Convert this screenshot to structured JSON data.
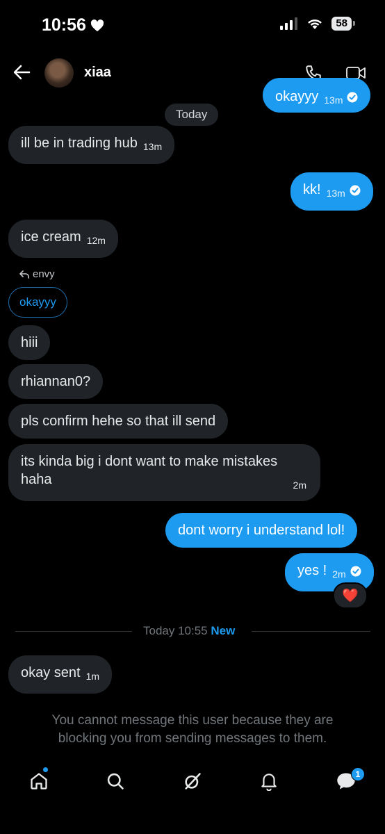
{
  "status_bar": {
    "time": "10:56",
    "battery": "58"
  },
  "header": {
    "name": "xiaa"
  },
  "messages": {
    "out_top": {
      "text": "okayyy",
      "time": "13m"
    },
    "date_pill": "Today",
    "m1": {
      "text": "ill be in trading hub",
      "time": "13m"
    },
    "m2": {
      "text": "kk!",
      "time": "13m"
    },
    "m3": {
      "text": "ice cream",
      "time": "12m"
    },
    "reply_to": "envy",
    "reply_quote": "okayyy",
    "m4": {
      "text": "hiii"
    },
    "m5": {
      "text": "rhiannan0?"
    },
    "m6": {
      "text": "pls confirm hehe so that ill send"
    },
    "m7": {
      "line1": "its kinda big i dont want to make mistakes",
      "line2": "haha",
      "time": "2m"
    },
    "m8": {
      "text": "dont worry i understand lol!"
    },
    "m9": {
      "text": "yes !",
      "time": "2m",
      "reaction": "❤️"
    }
  },
  "divider": {
    "label": "Today 10:55",
    "new_label": "New"
  },
  "last_message": {
    "text": "okay sent",
    "time": "1m"
  },
  "blocked_notice": "You cannot message this user because they are blocking you from sending messages to them.",
  "bottom_nav": {
    "messages_badge": "1"
  },
  "colors": {
    "accent": "#1d9bf0",
    "incoming_bubble": "#202327",
    "background": "#000000"
  }
}
